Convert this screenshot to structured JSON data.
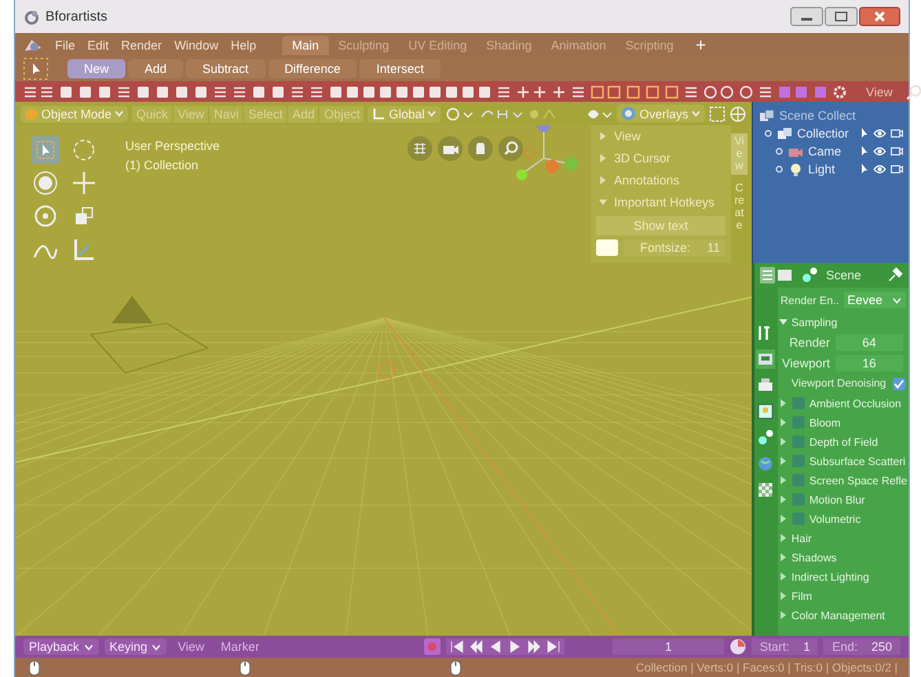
{
  "window": {
    "title": "Bforartists"
  },
  "menu": [
    "File",
    "Edit",
    "Render",
    "Window",
    "Help"
  ],
  "workspaces": [
    {
      "label": "Main",
      "selected": true
    },
    {
      "label": "Sculpting",
      "selected": false
    },
    {
      "label": "UV Editing",
      "selected": false
    },
    {
      "label": "Shading",
      "selected": false
    },
    {
      "label": "Animation",
      "selected": false
    },
    {
      "label": "Scripting",
      "selected": false
    }
  ],
  "add_workspace": "+",
  "boolean_tools": [
    {
      "label": "New",
      "selected": true
    },
    {
      "label": "Add",
      "selected": false
    },
    {
      "label": "Subtract",
      "selected": false
    },
    {
      "label": "Difference",
      "selected": false
    },
    {
      "label": "Intersect",
      "selected": false
    }
  ],
  "toolbar": {
    "view_label": "View"
  },
  "viewport": {
    "mode": "Object Mode",
    "menus": [
      "Quick",
      "View",
      "Navi",
      "Select",
      "Add",
      "Object"
    ],
    "orientation": "Global",
    "overlays": "Overlays",
    "perspective": "User Perspective",
    "collection": "(1) Collection",
    "sidebar": {
      "tabs": [
        {
          "label": "View",
          "selected": true
        },
        {
          "label": "Create",
          "selected": false
        }
      ],
      "panels": [
        {
          "label": "View",
          "expanded": false
        },
        {
          "label": "3D Cursor",
          "expanded": false
        },
        {
          "label": "Annotations",
          "expanded": false
        },
        {
          "label": "Important Hotkeys",
          "expanded": true
        }
      ],
      "show_text_button": "Show text",
      "fontsize_label": "Fontsize:",
      "fontsize_value": "11"
    }
  },
  "outliner": {
    "title": "Scene Collect",
    "tree": [
      {
        "label": "Collectior",
        "kind": "collection",
        "children": [
          {
            "label": "Came",
            "kind": "camera"
          },
          {
            "label": "Light",
            "kind": "light"
          }
        ]
      }
    ]
  },
  "properties": {
    "context": "Scene",
    "render_engine_label": "Render En..",
    "render_engine": "Eevee",
    "sampling": {
      "label": "Sampling",
      "expanded": true,
      "fields": [
        {
          "label": "Render",
          "value": "64"
        },
        {
          "label": "Viewport",
          "value": "16"
        }
      ],
      "denoising": {
        "label": "Viewport Denoising",
        "checked": true
      }
    },
    "panels": [
      {
        "label": "Ambient Occlusion",
        "kind": "toggle",
        "checked": false
      },
      {
        "label": "Bloom",
        "kind": "toggle",
        "checked": false
      },
      {
        "label": "Depth of Field",
        "kind": "toggle",
        "checked": false
      },
      {
        "label": "Subsurface Scatteri",
        "kind": "toggle",
        "checked": false
      },
      {
        "label": "Screen Space Refle",
        "kind": "toggle",
        "checked": false
      },
      {
        "label": "Motion Blur",
        "kind": "toggle",
        "checked": false
      },
      {
        "label": "Volumetric",
        "kind": "toggle",
        "checked": false
      },
      {
        "label": "Hair",
        "kind": "plain"
      },
      {
        "label": "Shadows",
        "kind": "plain"
      },
      {
        "label": "Indirect Lighting",
        "kind": "plain"
      },
      {
        "label": "Film",
        "kind": "plain"
      },
      {
        "label": "Color Management",
        "kind": "plain"
      }
    ]
  },
  "timeline": {
    "menus": [
      {
        "label": "Playback",
        "dropdown": true
      },
      {
        "label": "Keying",
        "dropdown": true
      },
      {
        "label": "View",
        "dropdown": false
      },
      {
        "label": "Marker",
        "dropdown": false
      }
    ],
    "frame": "1",
    "start_label": "Start:",
    "start": "1",
    "end_label": "End:",
    "end": "250"
  },
  "status_bar": {
    "stats": "Collection | Verts:0 | Faces:0 | Tris:0 | Objects:0/2 |"
  }
}
